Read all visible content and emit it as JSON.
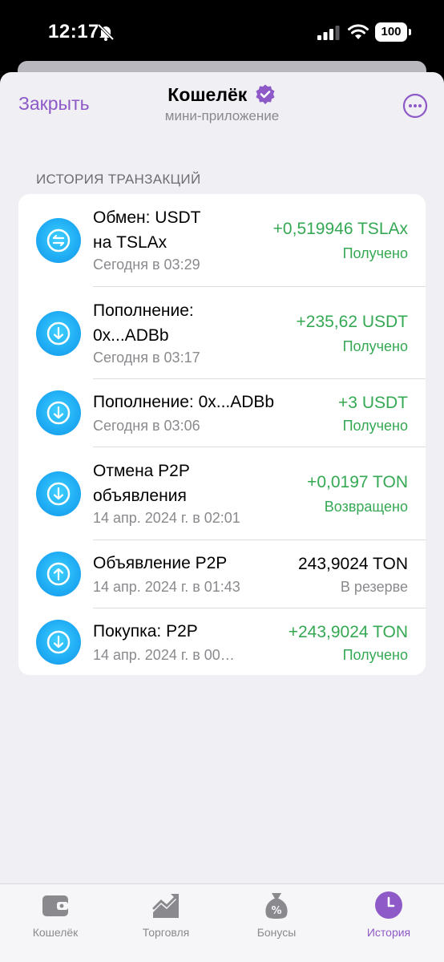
{
  "status_bar": {
    "time": "12:17",
    "battery": "100"
  },
  "header": {
    "close_label": "Закрыть",
    "title": "Кошелёк",
    "subtitle": "мини-приложение"
  },
  "section_title": "ИСТОРИЯ ТРАНЗАКЦИЙ",
  "transactions": [
    {
      "title_line1": "Обмен: USDT",
      "title_line2": "на TSLAx",
      "date": "Сегодня в 03:29",
      "amount": "+0,519946 TSLAx",
      "status": "Получено",
      "icon": "swap-icon"
    },
    {
      "title_line1": "Пополнение:",
      "title_line2": "0x...ADBb",
      "date": "Сегодня в 03:17",
      "amount": "+235,62 USDT",
      "status": "Получено",
      "icon": "arrow-down-icon"
    },
    {
      "title_line1": "Пополнение: 0x...ADBb",
      "title_line2": "",
      "date": "Сегодня в 03:06",
      "amount": "+3 USDT",
      "status": "Получено",
      "icon": "arrow-down-icon"
    },
    {
      "title_line1": "Отмена P2P",
      "title_line2": "объявления",
      "date": "14 апр. 2024 г. в 02:01",
      "amount": "+0,0197 TON",
      "status": "Возвращено",
      "icon": "arrow-down-icon"
    },
    {
      "title_line1": "Объявление P2P",
      "title_line2": "",
      "date": "14 апр. 2024 г. в 01:43",
      "amount": "243,9024 TON",
      "status": "В резерве",
      "icon": "arrow-up-icon"
    },
    {
      "title_line1": "Покупка: P2P",
      "title_line2": "",
      "date": "14 апр. 2024 г. в 00…",
      "amount": "+243,9024 TON",
      "status": "Получено",
      "icon": "arrow-down-icon"
    }
  ],
  "tabs": [
    {
      "label": "Кошелёк",
      "icon": "wallet-icon",
      "active": false
    },
    {
      "label": "Торговля",
      "icon": "trading-chart-icon",
      "active": false
    },
    {
      "label": "Бонусы",
      "icon": "bonus-bag-icon",
      "active": false
    },
    {
      "label": "История",
      "icon": "history-clock-icon",
      "active": true
    }
  ],
  "colors": {
    "accent": "#8e5ac8",
    "positive": "#34a853",
    "icon_blue": "#21aef5"
  }
}
